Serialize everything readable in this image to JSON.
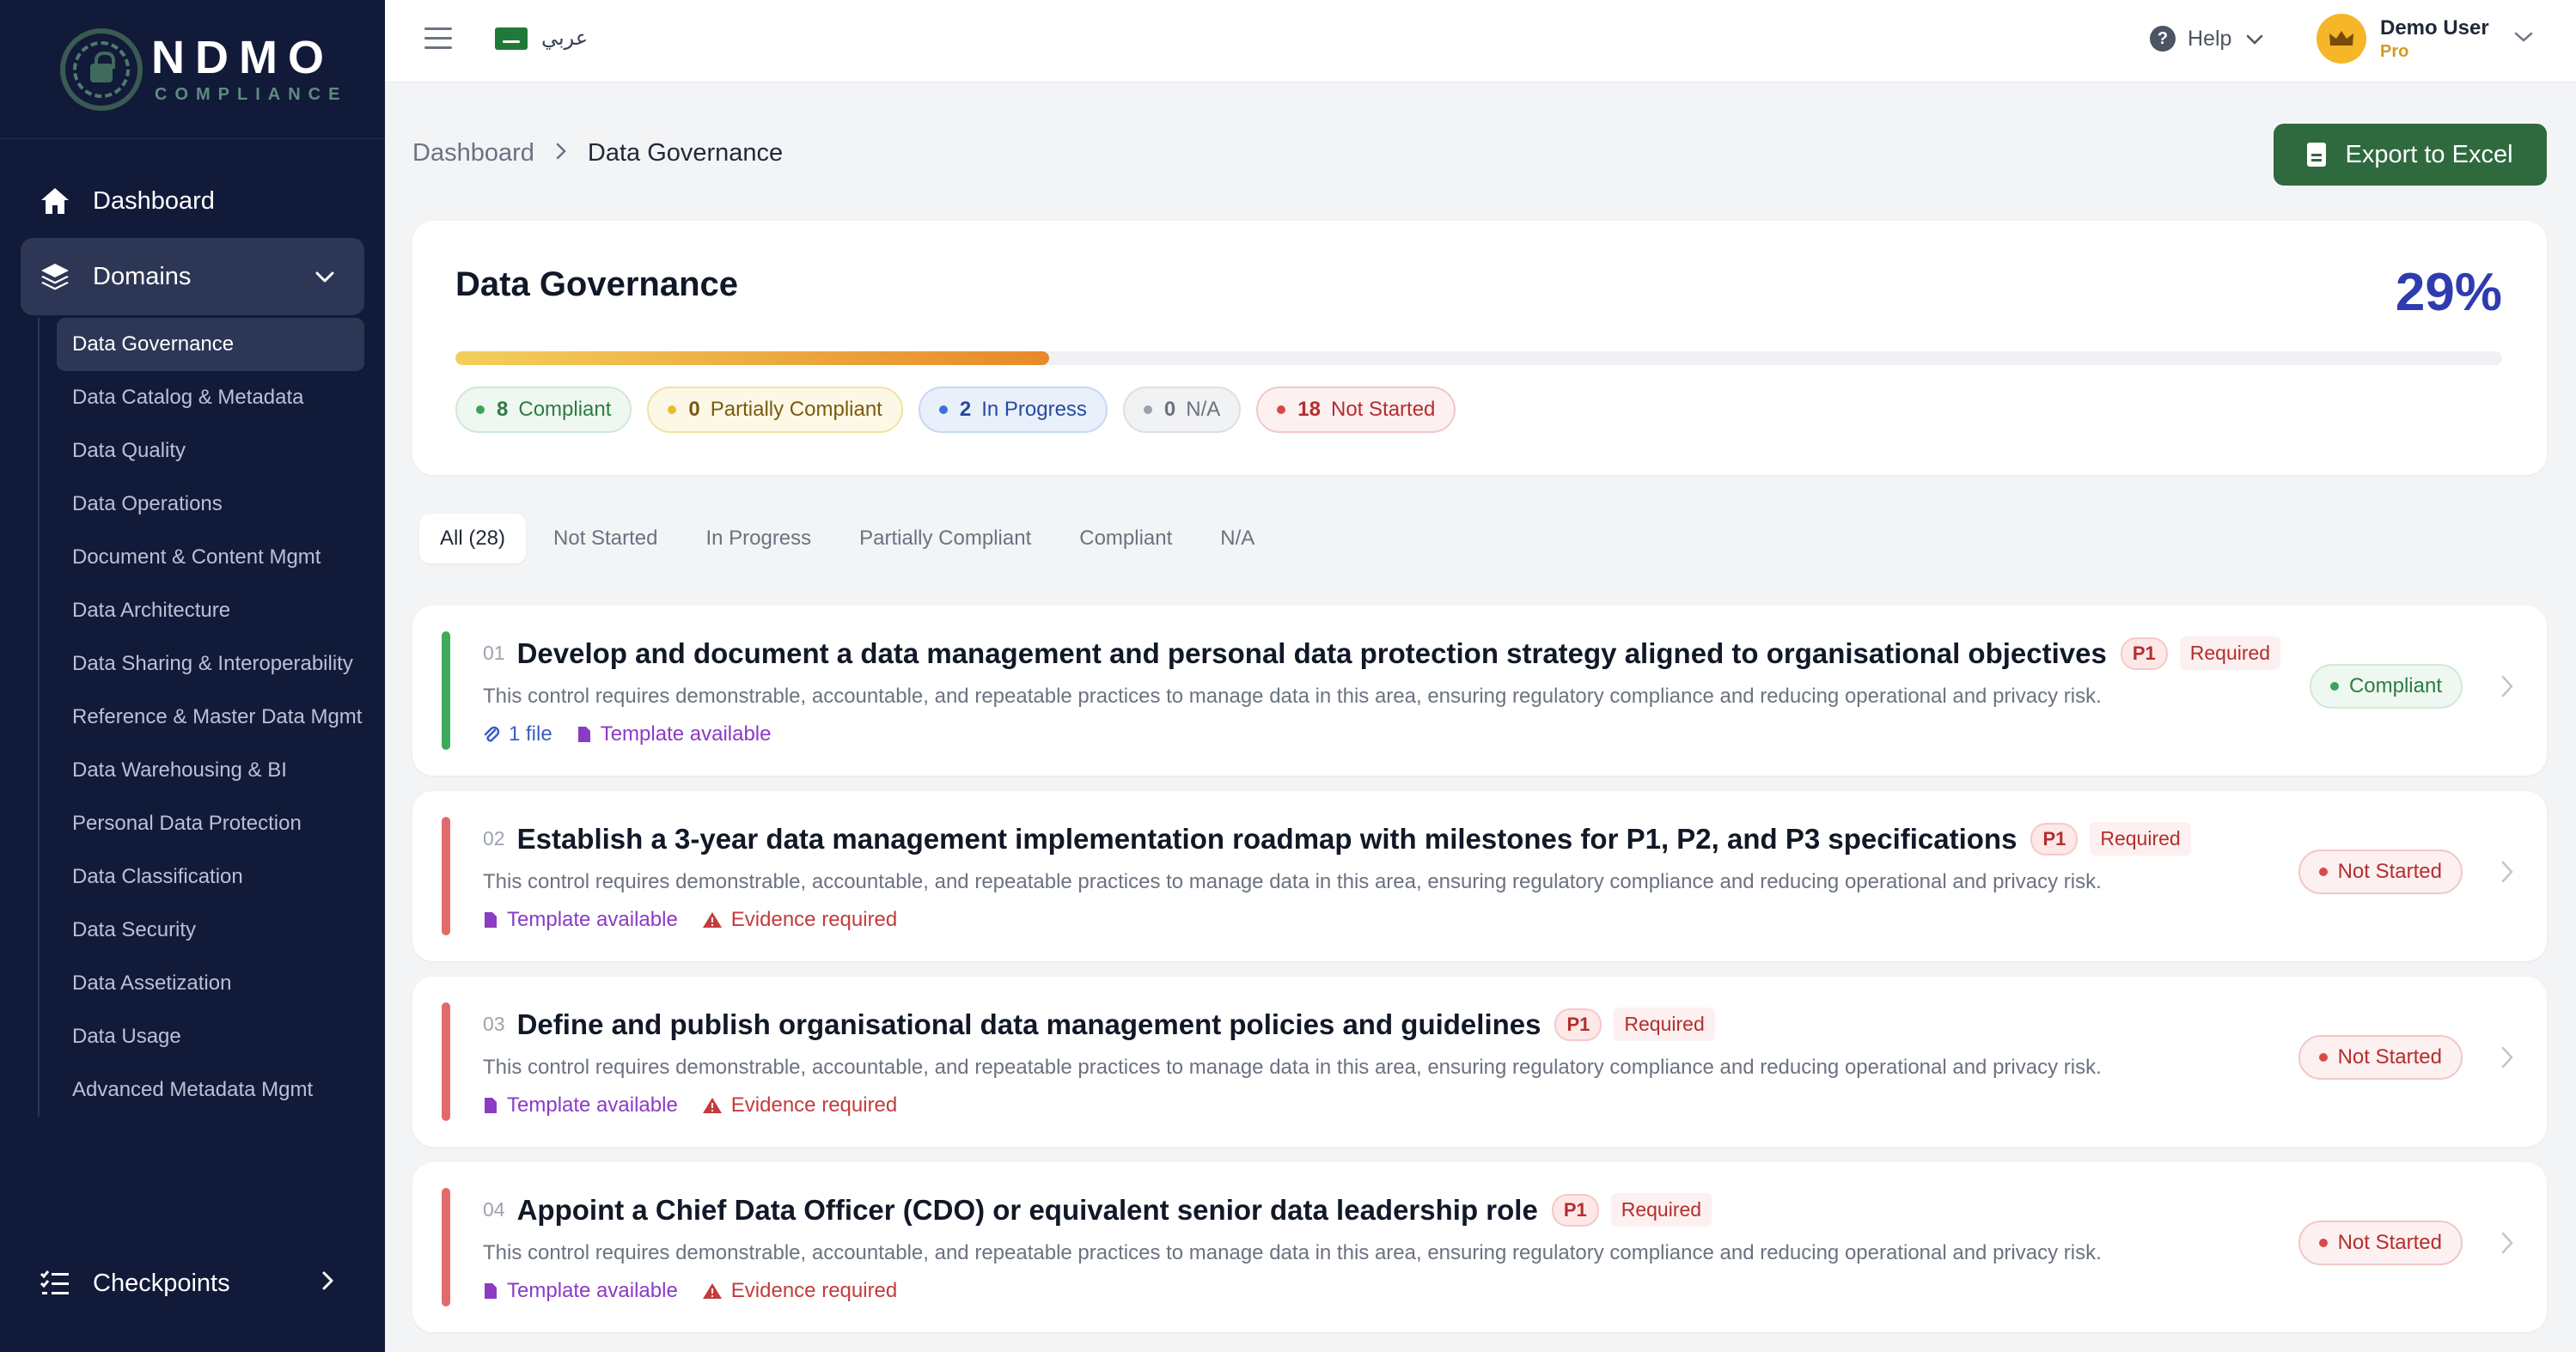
{
  "brand": {
    "title": "NDMO",
    "subtitle": "COMPLIANCE"
  },
  "sidebar": {
    "dashboard": "Dashboard",
    "domains": "Domains",
    "domain_items": [
      "Data Governance",
      "Data Catalog & Metadata",
      "Data Quality",
      "Data Operations",
      "Document & Content Mgmt",
      "Data Architecture",
      "Data Sharing & Interoperability",
      "Reference & Master Data Mgmt",
      "Data Warehousing & BI",
      "Personal Data Protection",
      "Data Classification",
      "Data Security",
      "Data Assetization",
      "Data Usage",
      "Advanced Metadata Mgmt"
    ],
    "checkpoints": "Checkpoints"
  },
  "topbar": {
    "language": "عربي",
    "help": "Help",
    "user_name": "Demo User",
    "user_plan": "Pro"
  },
  "breadcrumb": {
    "root": "Dashboard",
    "current": "Data Governance"
  },
  "export_label": "Export to Excel",
  "summary": {
    "title": "Data Governance",
    "percent": "29%",
    "progress_fraction": 0.29,
    "chips": [
      {
        "count": "8",
        "label": "Compliant"
      },
      {
        "count": "0",
        "label": "Partially Compliant"
      },
      {
        "count": "2",
        "label": "In Progress"
      },
      {
        "count": "0",
        "label": "N/A"
      },
      {
        "count": "18",
        "label": "Not Started"
      }
    ]
  },
  "tabs": [
    "All (28)",
    "Not Started",
    "In Progress",
    "Partially Compliant",
    "Compliant",
    "N/A"
  ],
  "controls": [
    {
      "num": "01",
      "title": "Develop and document a data management and personal data protection strategy aligned to organisational objectives",
      "priority": "P1",
      "required": "Required",
      "description": "This control requires demonstrable, accountable, and repeatable practices to manage data in this area, ensuring regulatory compliance and reducing operational and privacy risk.",
      "files": "1 file",
      "template": "Template available",
      "status": "Compliant"
    },
    {
      "num": "02",
      "title": "Establish a 3-year data management implementation roadmap with milestones for P1, P2, and P3 specifications",
      "priority": "P1",
      "required": "Required",
      "description": "This control requires demonstrable, accountable, and repeatable practices to manage data in this area, ensuring regulatory compliance and reducing operational and privacy risk.",
      "template": "Template available",
      "evidence": "Evidence required",
      "status": "Not Started"
    },
    {
      "num": "03",
      "title": "Define and publish organisational data management policies and guidelines",
      "priority": "P1",
      "required": "Required",
      "description": "This control requires demonstrable, accountable, and repeatable practices to manage data in this area, ensuring regulatory compliance and reducing operational and privacy risk.",
      "template": "Template available",
      "evidence": "Evidence required",
      "status": "Not Started"
    },
    {
      "num": "04",
      "title": "Appoint a Chief Data Officer (CDO) or equivalent senior data leadership role",
      "priority": "P1",
      "required": "Required",
      "description": "This control requires demonstrable, accountable, and repeatable practices to manage data in this area, ensuring regulatory compliance and reducing operational and privacy risk.",
      "template": "Template available",
      "evidence": "Evidence required",
      "status": "Not Started"
    }
  ],
  "colors": {
    "sidebar_bg": "#111a38",
    "accent_percent": "#2f3bb0",
    "export_bg": "#2f6a3f",
    "compliant": "#3fa95c",
    "not_started": "#e26a6a"
  }
}
